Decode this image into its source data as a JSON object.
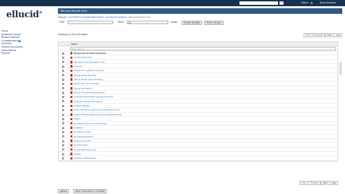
{
  "topbar": {
    "search_placeholder": "",
    "help_label": "Help ▾",
    "user_label": "Jenzn Ibrahan ▾"
  },
  "logo": {
    "text": "ellucid",
    "mark": "®"
  },
  "sidebar": {
    "items": [
      {
        "label": "Home"
      },
      {
        "label": "Advanced Search"
      },
      {
        "label": "Browse Manuals"
      },
      {
        "label": "Competencies",
        "badge": "0"
      },
      {
        "label": "Favorites"
      },
      {
        "label": "Recent Documents"
      },
      {
        "label": "Subscriptions"
      },
      {
        "label": "Reports"
      }
    ]
  },
  "main": {
    "title": "Skin and Wound Care",
    "breadcrumb": {
      "items": [
        "Manuals",
        "NCH MGFO Hospital Wide Policies",
        "Nursing Procedures"
      ],
      "current": "Skin and Wound Care"
    },
    "controls": {
      "field_label": "Field",
      "show_label": "Show",
      "show_value": "25",
      "entries_label": "entries",
      "restore_label": "Restore Defaults",
      "reset_label": "Reset Columns"
    },
    "showing_text": "Showing 1 to 25 of 26 entries",
    "pager": {
      "first": "First",
      "previous": "Previous",
      "next": "Next",
      "last": "Last"
    },
    "table": {
      "column_name": "Name",
      "filter_placeholder": "Filter Column",
      "group_title": "Wound Care Product Formulary",
      "rows": [
        "3-Z 5% Acetic Acid",
        "3M Cavilon No-sting Barrier Film",
        "Acticoat 7",
        "Adaptic Non-adherent Dressing",
        "Allevyn Island Dressing",
        "Allevyn Gentle Foam Dressing",
        "Allevyn Life Heel Dressing",
        "Allevyn Life Sacral",
        "Allevyn Trach Dressing (Classic)",
        "Anasept Antimicrobial Hydrogel (Contact)",
        "Aquacel & Aquacel AG (silver)",
        "Calcium Alginate",
        "Care of the Post-operative Chest/Sternal Incision",
        "Cavilon 3M skin cleanser and No Sting Barrier Film",
        "Cipro's",
        "Dermaplex Premium Cell (Flexible)",
        "Critaplast",
        "Dermaplex Ocean",
        "Dry Sterile Dressing",
        "Eucerin Extra Thin",
        "Excoria Cream",
        "G-Tube PEG Tube Care",
        "Mepilex",
        "Iodoform Packing Strips"
      ]
    },
    "footer": {
      "back_label": "◀ Back",
      "move_label": "Move Documents To Favorites"
    }
  }
}
